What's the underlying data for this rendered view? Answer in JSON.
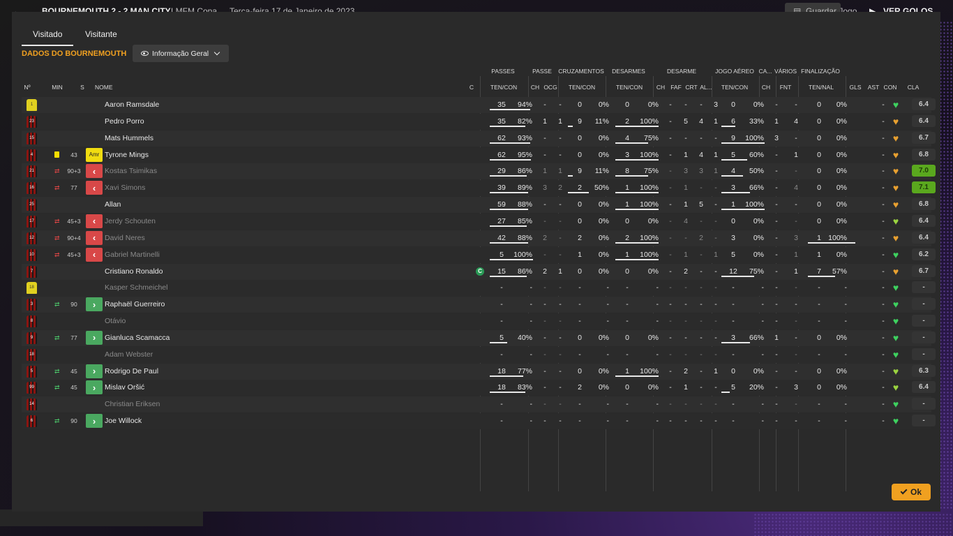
{
  "topbar": {
    "match": "BOURNEMOUTH  2 - 2  MAN CITY",
    "competition": "LMFM Copa",
    "date": "Terça-feira 17 de Janeiro de 2023",
    "save_label": "Guardar Jogo",
    "goals_label": "VER GOLOS"
  },
  "tabs": [
    "Visitado",
    "Visitante"
  ],
  "team_title": "DADOS DO BOURNEMOUTH",
  "view_dropdown": "Informação Geral",
  "groups": [
    "PASSES",
    "PASSE",
    "CRUZAMENTOS",
    "DESARMES",
    "DESARME",
    "JOGO AÉREO",
    "CA...",
    "VÁRIOS",
    "FINALIZAÇÃO"
  ],
  "columns": {
    "num": "Nº",
    "min": "MIN",
    "s": "S",
    "name": "NOME",
    "c": "C",
    "passes": "TEN/CON",
    "pass_ch": "CH",
    "pass_ocg": "OCG",
    "cross": "TEN/CON",
    "tack": "TEN/CON",
    "des_ch": "CH",
    "des_faf": "FAF",
    "des_crt": "CRT",
    "des_al": "AL...",
    "aer": "TEN/CON",
    "ca_ch": "CH",
    "var_fnt": "FNT",
    "fin": "TEN/NAL",
    "gls": "GLS",
    "ast": "AST",
    "con": "CON",
    "cla": "CLA"
  },
  "ok_label": "Ok",
  "players": [
    {
      "no": "1",
      "gk": true,
      "card": "",
      "subdir": "",
      "min": "",
      "pos": "",
      "name": "Aaron Ramsdale",
      "dim": false,
      "cap": "",
      "pa": "35",
      "pp": "94%",
      "pb": 0.94,
      "pch": "-",
      "pocg": "-",
      "ca": "0",
      "cp": "0%",
      "cb": 0,
      "ta": "0",
      "tp": "0%",
      "tb": 0,
      "dch": "-",
      "dfaf": "-",
      "dcrt": "-",
      "dal": "3",
      "aa": "0",
      "ap": "0%",
      "ab": 0,
      "cach": "-",
      "fnt": "-",
      "fa": "0",
      "fp": "0%",
      "fb": 0,
      "gls": "",
      "ast": "-",
      "heart": "green",
      "cla": "6.4",
      "hi": false
    },
    {
      "no": "23",
      "gk": false,
      "card": "",
      "subdir": "",
      "min": "",
      "pos": "",
      "name": "Pedro Porro",
      "dim": false,
      "cap": "",
      "pa": "35",
      "pp": "82%",
      "pb": 0.82,
      "pch": "1",
      "pocg": "1",
      "ca": "9",
      "cp": "11%",
      "cb": 0.11,
      "ta": "2",
      "tp": "100%",
      "tb": 1,
      "dch": "-",
      "dfaf": "5",
      "dcrt": "4",
      "dal": "1",
      "aa": "6",
      "ap": "33%",
      "ab": 0.33,
      "cach": "1",
      "fnt": "4",
      "fa": "0",
      "fp": "0%",
      "fb": 0,
      "gls": "",
      "ast": "-",
      "heart": "orange",
      "cla": "6.4",
      "hi": false
    },
    {
      "no": "15",
      "gk": false,
      "card": "",
      "subdir": "",
      "min": "",
      "pos": "",
      "name": "Mats Hummels",
      "dim": false,
      "cap": "",
      "pa": "62",
      "pp": "93%",
      "pb": 0.93,
      "pch": "-",
      "pocg": "-",
      "ca": "0",
      "cp": "0%",
      "cb": 0,
      "ta": "4",
      "tp": "75%",
      "tb": 0.75,
      "dch": "-",
      "dfaf": "-",
      "dcrt": "-",
      "dal": "-",
      "aa": "9",
      "ap": "100%",
      "ab": 1,
      "cach": "3",
      "fnt": "-",
      "fa": "0",
      "fp": "0%",
      "fb": 0,
      "gls": "",
      "ast": "-",
      "heart": "orange",
      "cla": "6.7",
      "hi": false
    },
    {
      "no": "4",
      "gk": false,
      "card": "yellow",
      "subdir": "",
      "min": "43",
      "pos": "amr",
      "name": "Tyrone Mings",
      "dim": false,
      "cap": "",
      "pa": "62",
      "pp": "95%",
      "pb": 0.95,
      "pch": "-",
      "pocg": "-",
      "ca": "0",
      "cp": "0%",
      "cb": 0,
      "ta": "3",
      "tp": "100%",
      "tb": 1,
      "dch": "-",
      "dfaf": "1",
      "dcrt": "4",
      "dal": "1",
      "aa": "5",
      "ap": "60%",
      "ab": 0.6,
      "cach": "-",
      "fnt": "1",
      "fa": "0",
      "fp": "0%",
      "fb": 0,
      "gls": "",
      "ast": "-",
      "heart": "orange",
      "cla": "6.8",
      "hi": false
    },
    {
      "no": "21",
      "gk": false,
      "card": "",
      "subdir": "out",
      "min": "90+3",
      "pos": "out",
      "name": "Kostas Tsimikas",
      "dim": true,
      "cap": "",
      "pa": "29",
      "pp": "86%",
      "pb": 0.86,
      "pch": "1",
      "pocg": "1",
      "ca": "9",
      "cp": "11%",
      "cb": 0.11,
      "ta": "8",
      "tp": "75%",
      "tb": 0.75,
      "dch": "-",
      "dfaf": "3",
      "dcrt": "3",
      "dal": "1",
      "aa": "4",
      "ap": "50%",
      "ab": 0.5,
      "cach": "-",
      "fnt": "-",
      "fa": "0",
      "fp": "0%",
      "fb": 0,
      "gls": "",
      "ast": "-",
      "heart": "orange",
      "cla": "7.0",
      "hi": true
    },
    {
      "no": "16",
      "gk": false,
      "card": "",
      "subdir": "out",
      "min": "77",
      "pos": "out",
      "name": "Xavi Simons",
      "dim": true,
      "cap": "",
      "pa": "39",
      "pp": "89%",
      "pb": 0.89,
      "pch": "3",
      "pocg": "2",
      "ca": "2",
      "cp": "50%",
      "cb": 0.5,
      "ta": "1",
      "tp": "100%",
      "tb": 1,
      "dch": "-",
      "dfaf": "1",
      "dcrt": "-",
      "dal": "-",
      "aa": "3",
      "ap": "66%",
      "ab": 0.66,
      "cach": "-",
      "fnt": "4",
      "fa": "0",
      "fp": "0%",
      "fb": 0,
      "gls": "",
      "ast": "-",
      "heart": "orange",
      "cla": "7.1",
      "hi": true
    },
    {
      "no": "25",
      "gk": false,
      "card": "",
      "subdir": "",
      "min": "",
      "pos": "",
      "name": "Allan",
      "dim": false,
      "cap": "",
      "pa": "59",
      "pp": "88%",
      "pb": 0.88,
      "pch": "-",
      "pocg": "-",
      "ca": "0",
      "cp": "0%",
      "cb": 0,
      "ta": "1",
      "tp": "100%",
      "tb": 1,
      "dch": "-",
      "dfaf": "1",
      "dcrt": "5",
      "dal": "-",
      "aa": "1",
      "ap": "100%",
      "ab": 1,
      "cach": "-",
      "fnt": "-",
      "fa": "0",
      "fp": "0%",
      "fb": 0,
      "gls": "",
      "ast": "-",
      "heart": "orange",
      "cla": "6.8",
      "hi": false
    },
    {
      "no": "17",
      "gk": false,
      "card": "",
      "subdir": "out",
      "min": "45+3",
      "pos": "out",
      "name": "Jerdy Schouten",
      "dim": true,
      "cap": "",
      "pa": "27",
      "pp": "85%",
      "pb": 0.85,
      "pch": "-",
      "pocg": "-",
      "ca": "0",
      "cp": "0%",
      "cb": 0,
      "ta": "0",
      "tp": "0%",
      "tb": 0,
      "dch": "-",
      "dfaf": "4",
      "dcrt": "-",
      "dal": "-",
      "aa": "0",
      "ap": "0%",
      "ab": 0,
      "cach": "-",
      "fnt": "-",
      "fa": "0",
      "fp": "0%",
      "fb": 0,
      "gls": "",
      "ast": "-",
      "heart": "greenish",
      "cla": "6.4",
      "hi": false
    },
    {
      "no": "12",
      "gk": false,
      "card": "",
      "subdir": "out",
      "min": "90+4",
      "pos": "out",
      "name": "David Neres",
      "dim": true,
      "cap": "",
      "pa": "42",
      "pp": "88%",
      "pb": 0.88,
      "pch": "2",
      "pocg": "-",
      "ca": "2",
      "cp": "0%",
      "cb": 0,
      "ta": "2",
      "tp": "100%",
      "tb": 1,
      "dch": "-",
      "dfaf": "-",
      "dcrt": "2",
      "dal": "-",
      "aa": "3",
      "ap": "0%",
      "ab": 0,
      "cach": "-",
      "fnt": "3",
      "fa": "1",
      "fp": "100%",
      "fb": 1,
      "gls": "",
      "ast": "-",
      "heart": "orange",
      "cla": "6.4",
      "hi": false
    },
    {
      "no": "10",
      "gk": false,
      "card": "",
      "subdir": "out",
      "min": "45+3",
      "pos": "out",
      "name": "Gabriel Martinelli",
      "dim": true,
      "cap": "",
      "pa": "5",
      "pp": "100%",
      "pb": 1,
      "pch": "-",
      "pocg": "-",
      "ca": "1",
      "cp": "0%",
      "cb": 0,
      "ta": "1",
      "tp": "100%",
      "tb": 1,
      "dch": "-",
      "dfaf": "1",
      "dcrt": "-",
      "dal": "1",
      "aa": "5",
      "ap": "0%",
      "ab": 0,
      "cach": "-",
      "fnt": "1",
      "fa": "1",
      "fp": "0%",
      "fb": 0,
      "gls": "",
      "ast": "-",
      "heart": "green",
      "cla": "6.2",
      "hi": false
    },
    {
      "no": "7",
      "gk": false,
      "card": "",
      "subdir": "",
      "min": "",
      "pos": "",
      "name": "Cristiano Ronaldo",
      "dim": false,
      "cap": "C",
      "pa": "15",
      "pp": "86%",
      "pb": 0.86,
      "pch": "2",
      "pocg": "1",
      "ca": "0",
      "cp": "0%",
      "cb": 0,
      "ta": "0",
      "tp": "0%",
      "tb": 0,
      "dch": "-",
      "dfaf": "2",
      "dcrt": "-",
      "dal": "-",
      "aa": "12",
      "ap": "75%",
      "ab": 0.75,
      "cach": "-",
      "fnt": "1",
      "fa": "7",
      "fp": "57%",
      "fb": 0.57,
      "gls": "",
      "ast": "-",
      "heart": "orange",
      "cla": "6.7",
      "hi": false
    },
    {
      "no": "18",
      "gk": true,
      "card": "",
      "subdir": "",
      "min": "",
      "pos": "",
      "name": "Kasper Schmeichel",
      "dim": true,
      "cap": "",
      "pa": "-",
      "pp": "-",
      "pb": 0,
      "pch": "-",
      "pocg": "-",
      "ca": "-",
      "cp": "-",
      "cb": 0,
      "ta": "-",
      "tp": "-",
      "tb": 0,
      "dch": "-",
      "dfaf": "-",
      "dcrt": "-",
      "dal": "-",
      "aa": "-",
      "ap": "-",
      "ab": 0,
      "cach": "-",
      "fnt": "-",
      "fa": "-",
      "fp": "-",
      "fb": 0,
      "gls": "",
      "ast": "-",
      "heart": "green",
      "cla": "-",
      "hi": false
    },
    {
      "no": "3",
      "gk": false,
      "card": "",
      "subdir": "in",
      "min": "90",
      "pos": "in",
      "name": "Raphaël Guerreiro",
      "dim": false,
      "cap": "",
      "pa": "-",
      "pp": "-",
      "pb": 0,
      "pch": "-",
      "pocg": "-",
      "ca": "-",
      "cp": "-",
      "cb": 0,
      "ta": "-",
      "tp": "-",
      "tb": 0,
      "dch": "-",
      "dfaf": "-",
      "dcrt": "-",
      "dal": "-",
      "aa": "-",
      "ap": "-",
      "ab": 0,
      "cach": "-",
      "fnt": "-",
      "fa": "-",
      "fp": "-",
      "fb": 0,
      "gls": "",
      "ast": "-",
      "heart": "green",
      "cla": "-",
      "hi": false
    },
    {
      "no": "8",
      "gk": false,
      "card": "",
      "subdir": "",
      "min": "",
      "pos": "",
      "name": "Otávio",
      "dim": true,
      "cap": "",
      "pa": "-",
      "pp": "-",
      "pb": 0,
      "pch": "-",
      "pocg": "-",
      "ca": "-",
      "cp": "-",
      "cb": 0,
      "ta": "-",
      "tp": "-",
      "tb": 0,
      "dch": "-",
      "dfaf": "-",
      "dcrt": "-",
      "dal": "-",
      "aa": "-",
      "ap": "-",
      "ab": 0,
      "cach": "-",
      "fnt": "-",
      "fa": "-",
      "fp": "-",
      "fb": 0,
      "gls": "",
      "ast": "-",
      "heart": "green",
      "cla": "-",
      "hi": false
    },
    {
      "no": "9",
      "gk": false,
      "card": "",
      "subdir": "in",
      "min": "77",
      "pos": "in",
      "name": "Gianluca Scamacca",
      "dim": false,
      "cap": "",
      "pa": "5",
      "pp": "40%",
      "pb": 0.4,
      "pch": "-",
      "pocg": "-",
      "ca": "0",
      "cp": "0%",
      "cb": 0,
      "ta": "0",
      "tp": "0%",
      "tb": 0,
      "dch": "-",
      "dfaf": "-",
      "dcrt": "-",
      "dal": "-",
      "aa": "3",
      "ap": "66%",
      "ab": 0.66,
      "cach": "1",
      "fnt": "-",
      "fa": "0",
      "fp": "0%",
      "fb": 0,
      "gls": "",
      "ast": "-",
      "heart": "green",
      "cla": "-",
      "hi": false
    },
    {
      "no": "18",
      "gk": false,
      "card": "",
      "subdir": "",
      "min": "",
      "pos": "",
      "name": "Adam Webster",
      "dim": true,
      "cap": "",
      "pa": "-",
      "pp": "-",
      "pb": 0,
      "pch": "-",
      "pocg": "-",
      "ca": "-",
      "cp": "-",
      "cb": 0,
      "ta": "-",
      "tp": "-",
      "tb": 0,
      "dch": "-",
      "dfaf": "-",
      "dcrt": "-",
      "dal": "-",
      "aa": "-",
      "ap": "-",
      "ab": 0,
      "cach": "-",
      "fnt": "-",
      "fa": "-",
      "fp": "-",
      "fb": 0,
      "gls": "",
      "ast": "-",
      "heart": "green",
      "cla": "-",
      "hi": false
    },
    {
      "no": "5",
      "gk": false,
      "card": "",
      "subdir": "in",
      "min": "45",
      "pos": "in",
      "name": "Rodrigo De Paul",
      "dim": false,
      "cap": "",
      "pa": "18",
      "pp": "77%",
      "pb": 0.77,
      "pch": "-",
      "pocg": "-",
      "ca": "0",
      "cp": "0%",
      "cb": 0,
      "ta": "1",
      "tp": "100%",
      "tb": 1,
      "dch": "-",
      "dfaf": "2",
      "dcrt": "-",
      "dal": "1",
      "aa": "0",
      "ap": "0%",
      "ab": 0,
      "cach": "-",
      "fnt": "-",
      "fa": "0",
      "fp": "0%",
      "fb": 0,
      "gls": "",
      "ast": "-",
      "heart": "greenish",
      "cla": "6.3",
      "hi": false
    },
    {
      "no": "99",
      "gk": false,
      "card": "",
      "subdir": "in",
      "min": "45",
      "pos": "in",
      "name": "Mislav Oršić",
      "dim": false,
      "cap": "",
      "pa": "18",
      "pp": "83%",
      "pb": 0.83,
      "pch": "-",
      "pocg": "-",
      "ca": "2",
      "cp": "0%",
      "cb": 0,
      "ta": "0",
      "tp": "0%",
      "tb": 0,
      "dch": "-",
      "dfaf": "1",
      "dcrt": "-",
      "dal": "-",
      "aa": "5",
      "ap": "20%",
      "ab": 0.2,
      "cach": "-",
      "fnt": "3",
      "fa": "0",
      "fp": "0%",
      "fb": 0,
      "gls": "",
      "ast": "-",
      "heart": "greenish",
      "cla": "6.4",
      "hi": false
    },
    {
      "no": "14",
      "gk": false,
      "card": "",
      "subdir": "",
      "min": "",
      "pos": "",
      "name": "Christian Eriksen",
      "dim": true,
      "cap": "",
      "pa": "-",
      "pp": "-",
      "pb": 0,
      "pch": "-",
      "pocg": "-",
      "ca": "-",
      "cp": "-",
      "cb": 0,
      "ta": "-",
      "tp": "-",
      "tb": 0,
      "dch": "-",
      "dfaf": "-",
      "dcrt": "-",
      "dal": "-",
      "aa": "-",
      "ap": "-",
      "ab": 0,
      "cach": "-",
      "fnt": "-",
      "fa": "-",
      "fp": "-",
      "fb": 0,
      "gls": "",
      "ast": "-",
      "heart": "green",
      "cla": "-",
      "hi": false
    },
    {
      "no": "6",
      "gk": false,
      "card": "",
      "subdir": "in",
      "min": "90",
      "pos": "in",
      "name": "Joe Willock",
      "dim": false,
      "cap": "",
      "pa": "-",
      "pp": "-",
      "pb": 0,
      "pch": "-",
      "pocg": "-",
      "ca": "-",
      "cp": "-",
      "cb": 0,
      "ta": "-",
      "tp": "-",
      "tb": 0,
      "dch": "-",
      "dfaf": "-",
      "dcrt": "-",
      "dal": "-",
      "aa": "-",
      "ap": "-",
      "ab": 0,
      "cach": "-",
      "fnt": "-",
      "fa": "-",
      "fp": "-",
      "fb": 0,
      "gls": "",
      "ast": "-",
      "heart": "green",
      "cla": "-",
      "hi": false
    }
  ],
  "colors": {
    "accent": "#f0a020",
    "rating_high": "#5aa81e",
    "heart_green": "#3ed15f",
    "heart_orange": "#e8a030",
    "sub_in": "#4cc76a",
    "sub_out": "#e04646"
  }
}
